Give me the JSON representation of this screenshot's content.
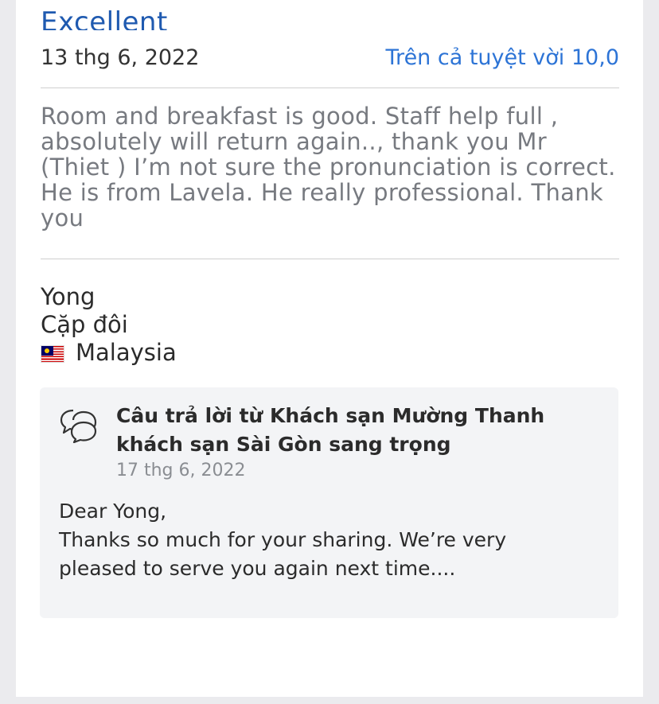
{
  "review": {
    "title_partial": "Excellent",
    "date": "13 thg 6, 2022",
    "rating_link": "Trên cả tuyệt vời 10,0",
    "text": "Room and breakfast is good. Staff help full , absolutely will return again.., thank you Mr (Thiet ) I’m not sure the pronunciation is correct. He is from Lavela. He really professional. Thank you"
  },
  "reviewer": {
    "name": "Yong",
    "traveler_type": "Cặp đôi",
    "country": "Malaysia",
    "flag_icon": "malaysia-flag-icon"
  },
  "reply": {
    "icon": "speech-bubbles-icon",
    "title": "Câu trả lời từ Khách sạn Mường Thanh khách sạn Sài Gòn sang trọng",
    "date": "17 thg 6, 2022",
    "lines": [
      "Dear Yong,",
      "Thanks so much for your sharing. We’re very",
      "pleased to serve you again next time...."
    ]
  },
  "colors": {
    "link": "#2d74d6",
    "title": "#1f5ab0",
    "muted_text": "#777a80",
    "reply_bg": "#f3f4f6"
  }
}
